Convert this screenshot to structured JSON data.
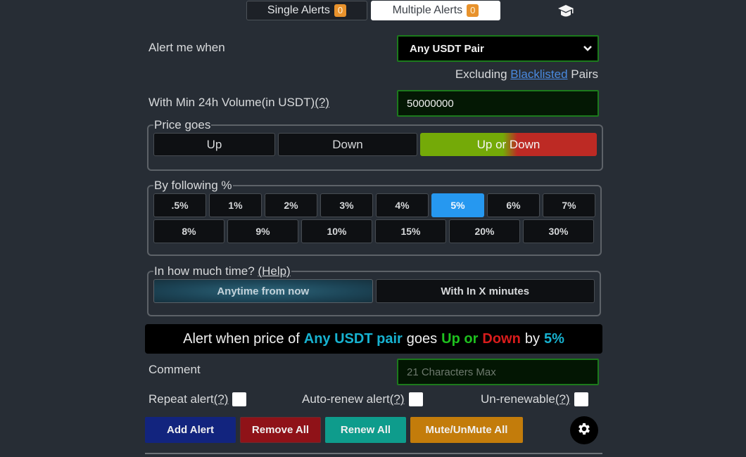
{
  "tabs": [
    {
      "label": "Single Alerts",
      "count": "0",
      "active": false
    },
    {
      "label": "Multiple Alerts",
      "count": "0",
      "active": true
    }
  ],
  "header_icon": "graduation-cap-icon",
  "form": {
    "alert_when_label": "Alert me when",
    "pair_select_value": "Any USDT Pair",
    "excluding_prefix": "Excluding",
    "excluding_link": "Blacklisted",
    "excluding_suffix": "Pairs",
    "volume_label": "With Min 24h Volume(in USDT)",
    "volume_help": "(?)",
    "volume_value": "50000000",
    "price_goes": {
      "legend": "Price goes",
      "options": [
        "Up",
        "Down",
        "Up or Down"
      ],
      "selected": "Up or Down"
    },
    "by_percent": {
      "legend": "By following %",
      "row1": [
        ".5%",
        "1%",
        "2%",
        "3%",
        "4%",
        "5%",
        "6%",
        "7%"
      ],
      "row2": [
        "8%",
        "9%",
        "10%",
        "15%",
        "20%",
        "30%"
      ],
      "selected": "5%"
    },
    "time": {
      "legend": "In how much time?",
      "help": "(Help)",
      "options": [
        "Anytime from now",
        "With In X minutes"
      ],
      "selected": "Anytime from now"
    },
    "summary": {
      "p1": "Alert when price of",
      "pair": "Any USDT pair",
      "p2": "goes",
      "up_or": "Up or",
      "down": "Down",
      "p3": "by",
      "pct": "5%"
    },
    "comment_label": "Comment",
    "comment_placeholder": "21 Characters Max",
    "checkboxes": [
      {
        "label": "Repeat alert",
        "help": "(?)",
        "checked": false
      },
      {
        "label": "Auto-renew alert",
        "help": "(?)",
        "checked": false
      },
      {
        "label": "Un-renewable",
        "help": "(?)",
        "checked": false
      }
    ]
  },
  "actions": {
    "add": "Add Alert",
    "remove_all": "Remove All",
    "renew_all": "Renew All",
    "mute_all": "Mute/UnMute All",
    "settings_icon": "gear-icon"
  },
  "colors": {
    "background": "#272d35",
    "selected_percent": "#2698f0",
    "up": "#74aa08",
    "down": "#bd2a24",
    "add": "#12247e",
    "remove": "#8f1218",
    "renew": "#0e9c8c",
    "mute": "#c37c0b",
    "badge": "#e8922c"
  }
}
